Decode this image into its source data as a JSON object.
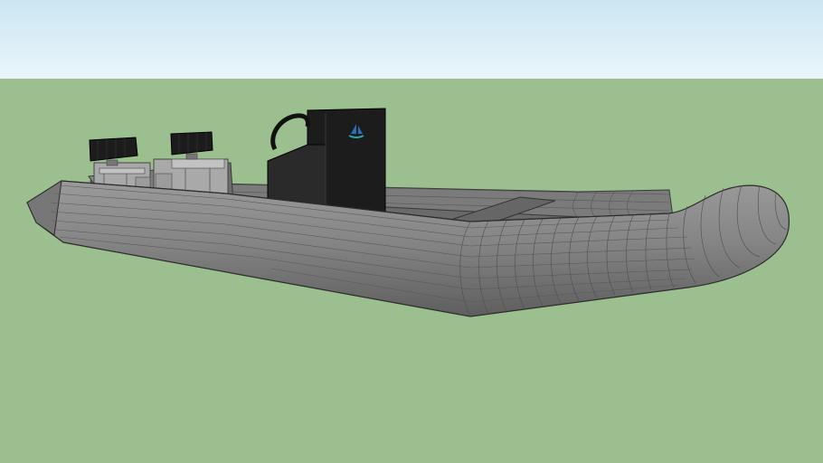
{
  "scene": {
    "sky_color_top": "#cbe6f2",
    "sky_color_bottom": "#e8f4fa",
    "ground_color": "#9bbf8e",
    "model": "rigid-inflatable-boat",
    "tube_color": "#808080",
    "console_color": "#202020",
    "floor_color": "#6d6d6d",
    "engine_color": "#1c1c1c",
    "logo_icon": "sailboat-icon",
    "logo_color": "#2a6fb5",
    "logo_wave_color": "#2aa6a6"
  }
}
